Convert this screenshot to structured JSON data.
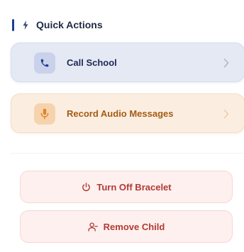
{
  "section": {
    "title": "Quick Actions",
    "icon": "bolt-icon"
  },
  "actions": [
    {
      "label": "Call School",
      "icon": "phone-icon",
      "accent": "#1f3f8f"
    },
    {
      "label": "Record Audio Messages",
      "icon": "microphone-icon",
      "accent": "#e0852c"
    }
  ],
  "danger_actions": [
    {
      "label": "Turn Off Bracelet",
      "icon": "power-icon"
    },
    {
      "label": "Remove Child",
      "icon": "remove-user-icon"
    }
  ],
  "colors": {
    "brand": "#1f3f8f",
    "danger": "#b23a33",
    "warning": "#e0852c"
  }
}
